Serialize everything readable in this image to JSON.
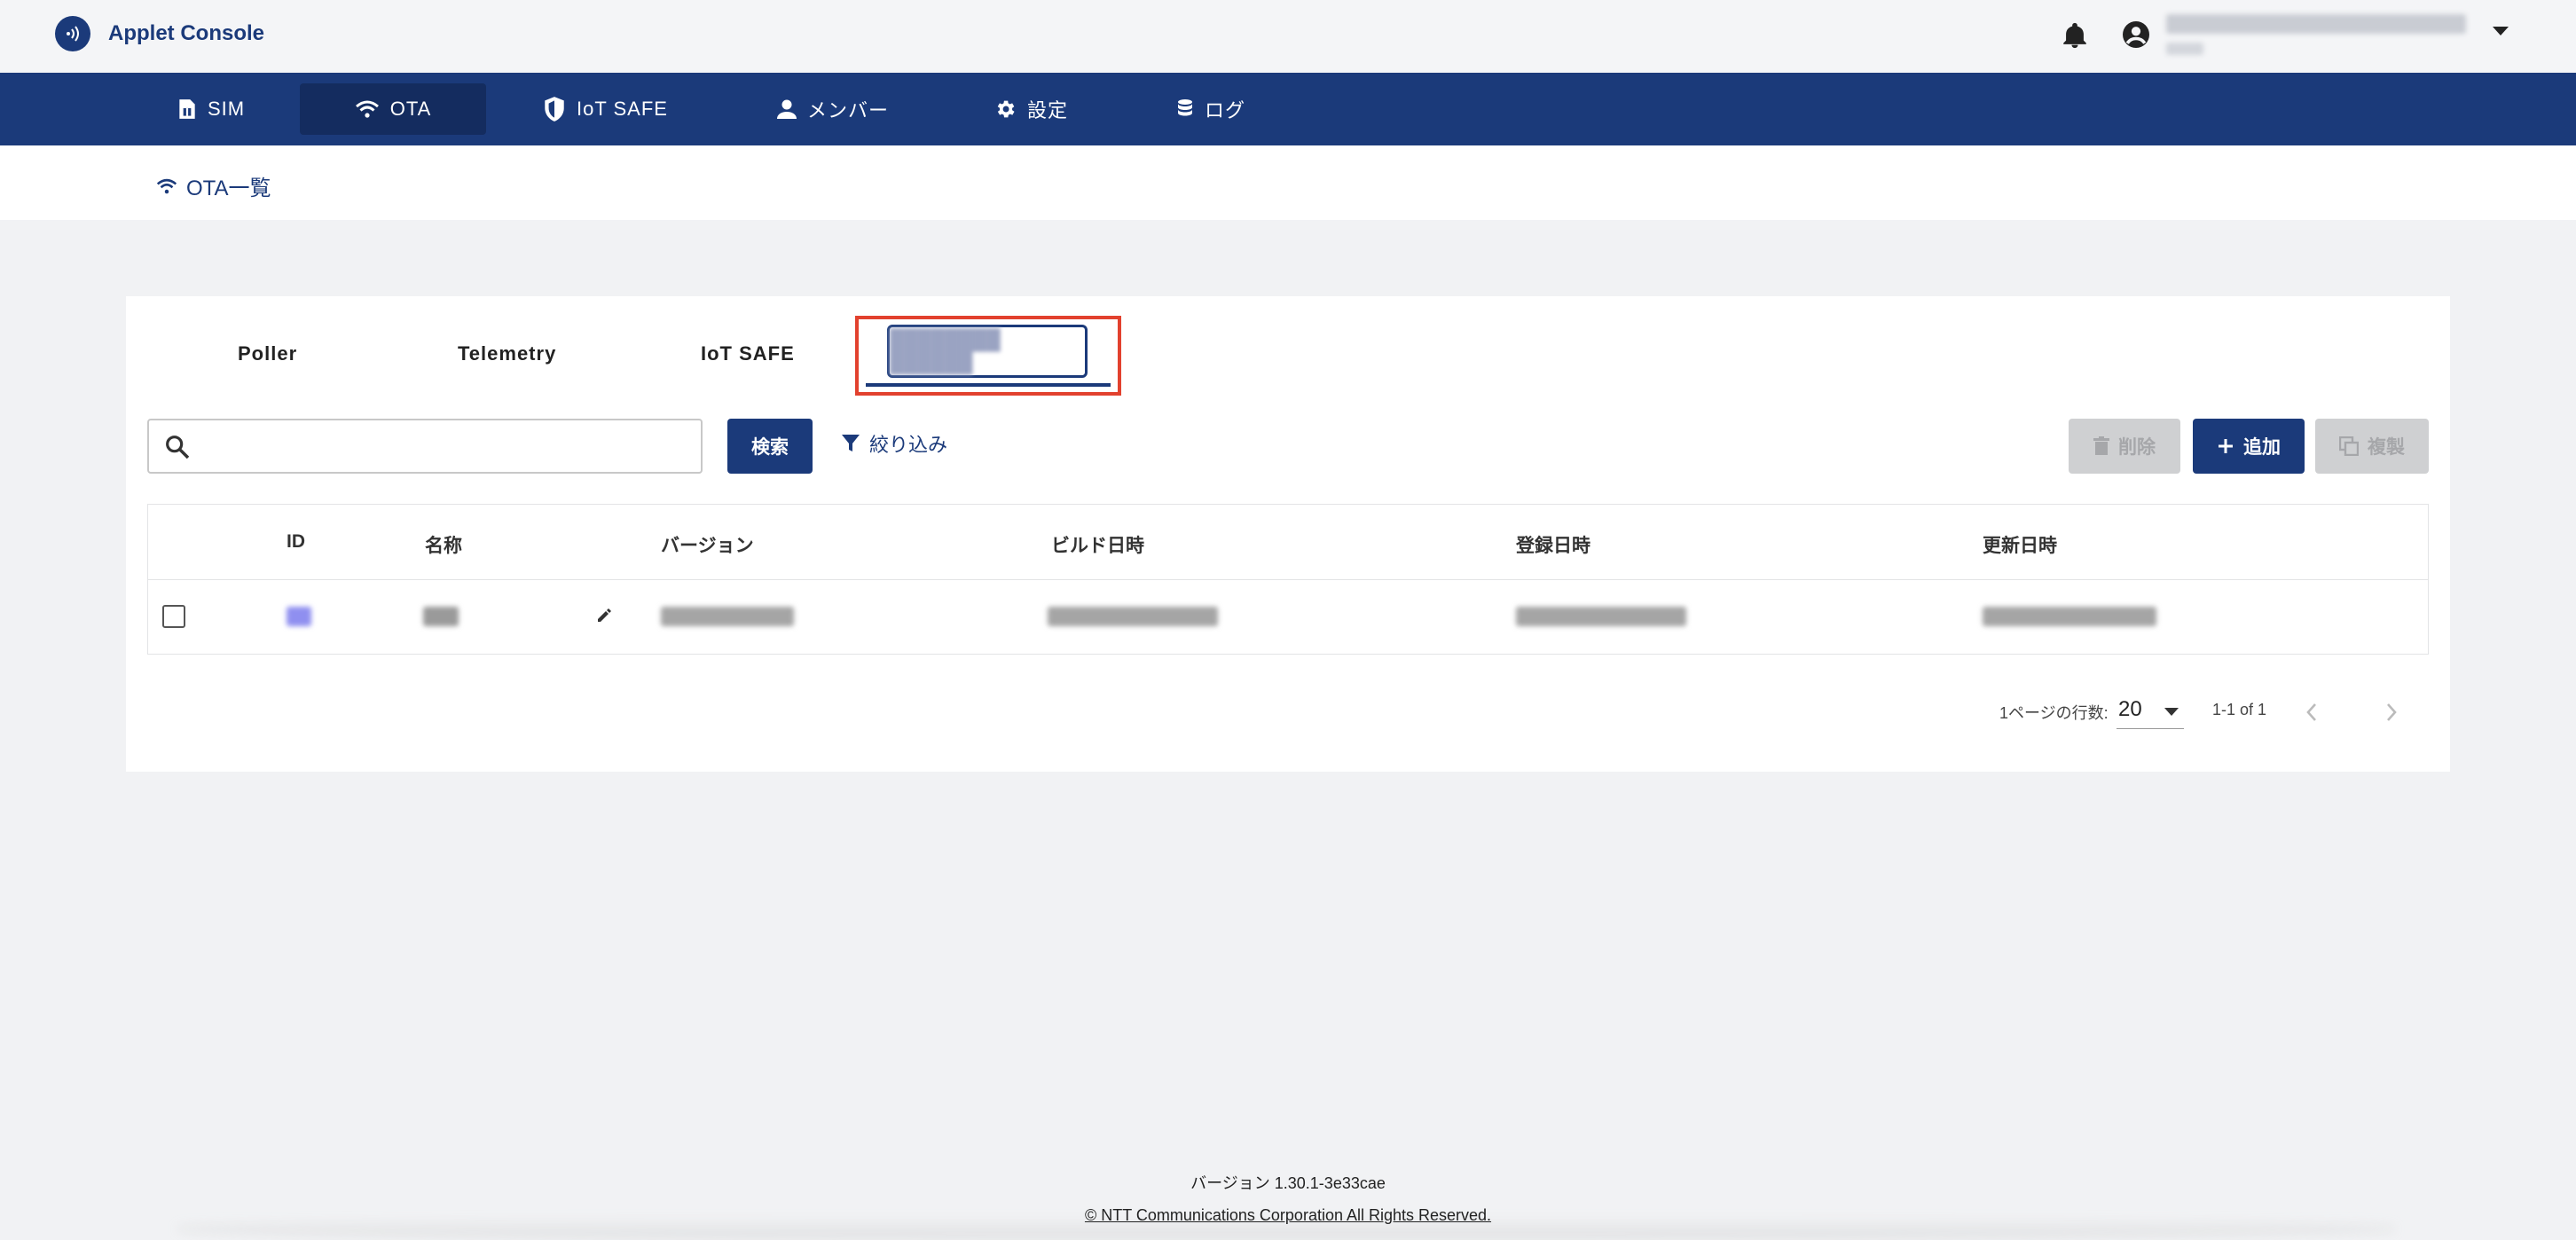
{
  "header": {
    "app_title": "Applet Console",
    "icons": {
      "logo": "nfc-signal-icon",
      "notifications": "bell-icon",
      "account": "account-circle-icon",
      "account_menu": "caret-down-icon"
    }
  },
  "nav": {
    "items": [
      {
        "label": "SIM",
        "icon": "sim-card-icon",
        "active": false
      },
      {
        "label": "OTA",
        "icon": "wifi-icon",
        "active": true
      },
      {
        "label": "IoT SAFE",
        "icon": "shield-icon",
        "active": false
      },
      {
        "label": "メンバー",
        "icon": "person-icon",
        "active": false
      },
      {
        "label": "設定",
        "icon": "gear-icon",
        "active": false
      },
      {
        "label": "ログ",
        "icon": "database-icon",
        "active": false
      }
    ]
  },
  "breadcrumb": {
    "label": "OTA一覧",
    "icon": "wifi-icon"
  },
  "tabs": {
    "items": [
      {
        "label": "Poller"
      },
      {
        "label": "Telemetry"
      },
      {
        "label": "IoT SAFE"
      },
      {
        "label": "",
        "redacted": true,
        "selected": true
      }
    ]
  },
  "toolbar": {
    "search_placeholder": "",
    "search_value": "",
    "search_button": "検索",
    "filter_label": "絞り込み",
    "delete_label": "削除",
    "add_label": "追加",
    "duplicate_label": "複製"
  },
  "table": {
    "columns": [
      "ID",
      "名称",
      "バージョン",
      "ビルド日時",
      "登録日時",
      "更新日時"
    ],
    "rows": [
      {
        "id": "",
        "name": "",
        "version": "",
        "build_date": "",
        "registered": "",
        "updated": "",
        "redacted": true
      }
    ]
  },
  "pagination": {
    "rows_per_page_label": "1ページの行数:",
    "rows_per_page": "20",
    "range": "1-1 of 1"
  },
  "footer": {
    "version": "バージョン 1.30.1-3e33cae",
    "copyright": "© NTT Communications Corporation All Rights Reserved."
  },
  "colors": {
    "brand": "#1b3a7a",
    "highlight": "#e2412e",
    "background": "#f1f2f4"
  }
}
